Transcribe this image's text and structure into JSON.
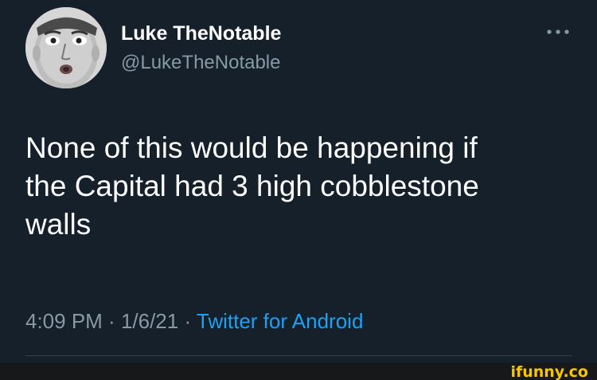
{
  "tweet": {
    "author": {
      "display_name": "Luke TheNotable",
      "handle": "@LukeTheNotable"
    },
    "text_lines": [
      "None of this would be happening if",
      "the Capital had 3 high cobblestone",
      "walls"
    ],
    "time": "4:09 PM",
    "separator": " · ",
    "date": "1/6/21",
    "source": "Twitter for Android",
    "more_icon": "more-horizontal-icon"
  },
  "watermark": {
    "text": "ifunny.co"
  },
  "colors": {
    "background": "#15202b",
    "text": "#ffffff",
    "secondary_text": "#8899a6",
    "link": "#1da1f2",
    "divider": "#38444d",
    "watermark": "#f7c600"
  }
}
